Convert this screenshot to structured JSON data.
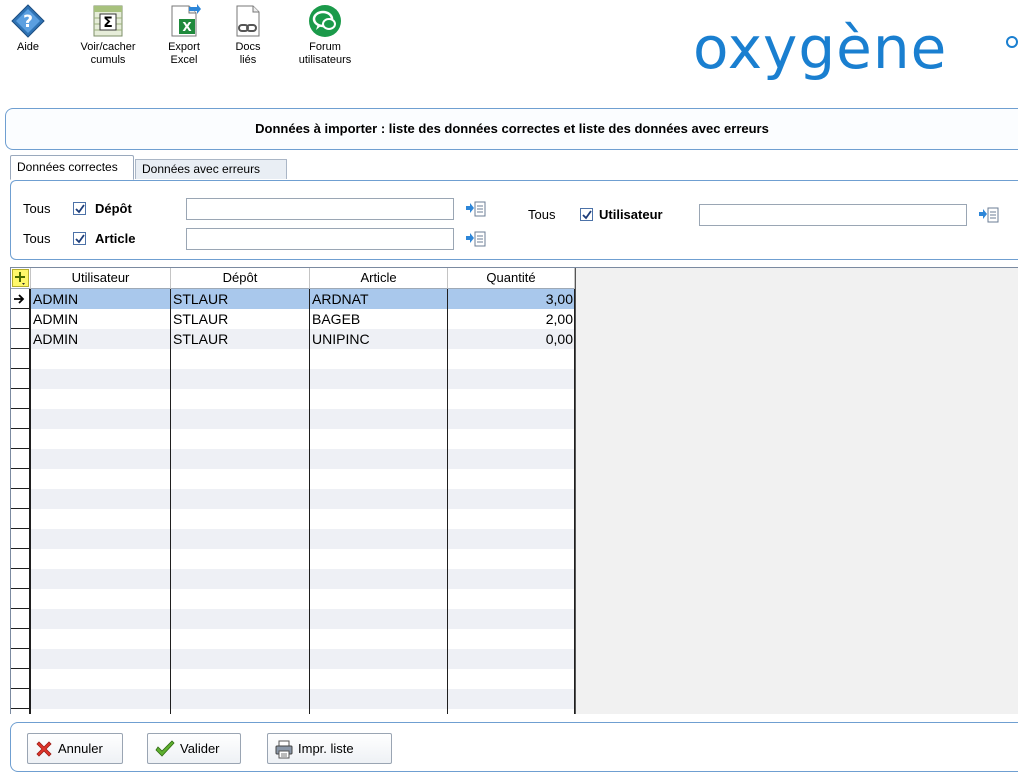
{
  "toolbar": {
    "items": [
      {
        "label": "Aide",
        "icon": "help-diamond-icon"
      },
      {
        "label": "Voir/cacher\ncumuls",
        "icon": "sigma-icon"
      },
      {
        "label": "Export\nExcel",
        "icon": "excel-export-icon"
      },
      {
        "label": "Docs\nliés",
        "icon": "linked-docs-icon"
      },
      {
        "label": "Forum\nutilisateurs",
        "icon": "forum-icon"
      }
    ],
    "logo": "oxygène"
  },
  "title": "Données à importer : liste des données correctes et liste des données avec erreurs",
  "tabs": [
    {
      "label": "Données correctes",
      "active": true
    },
    {
      "label": "Données avec erreurs",
      "active": false
    }
  ],
  "filters": {
    "depot": {
      "tous": "Tous",
      "label": "Dépôt",
      "checked": true,
      "value": ""
    },
    "article": {
      "tous": "Tous",
      "label": "Article",
      "checked": true,
      "value": ""
    },
    "utilisateur": {
      "tous": "Tous",
      "label": "Utilisateur",
      "checked": true,
      "value": ""
    }
  },
  "grid": {
    "columns": [
      "Utilisateur",
      "Dépôt",
      "Article",
      "Quantité"
    ],
    "rows": [
      {
        "utilisateur": "ADMIN",
        "depot": "STLAUR",
        "article": "ARDNAT",
        "quantite": "3,00",
        "selected": true
      },
      {
        "utilisateur": "ADMIN",
        "depot": "STLAUR",
        "article": "BAGEB",
        "quantite": "2,00",
        "selected": false
      },
      {
        "utilisateur": "ADMIN",
        "depot": "STLAUR",
        "article": "UNIPINC",
        "quantite": "0,00",
        "selected": false
      }
    ]
  },
  "buttons": {
    "annuler": "Annuler",
    "valider": "Valider",
    "imprimer": "Impr. liste"
  },
  "colors": {
    "accent": "#1a7fd0",
    "panel_border": "#6f9fd1",
    "row_selected": "#a9c8ec",
    "row_alt": "#eef0f5"
  }
}
